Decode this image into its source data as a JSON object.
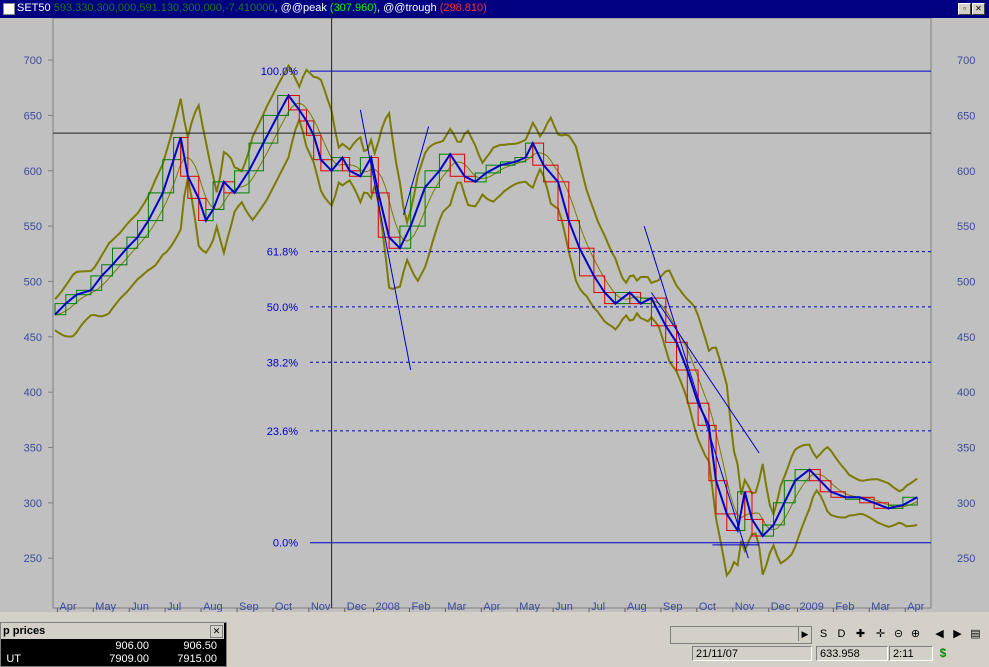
{
  "titlebar": {
    "symbol": "SET50",
    "values": "593.330,300,000,591.130,300,000,-7.410000",
    "peak_label": "@@peak",
    "peak_value": "(307.960)",
    "trough_label": "@@trough",
    "trough_value": "(298.810)"
  },
  "chart_data": {
    "type": "line",
    "y_ticks": [
      250,
      300,
      350,
      400,
      450,
      500,
      550,
      600,
      650,
      700
    ],
    "ylim": [
      205,
      738
    ],
    "x_ticks": [
      {
        "label": "Apr",
        "t": 0.4
      },
      {
        "label": "May",
        "t": 1.4
      },
      {
        "label": "Jun",
        "t": 2.4
      },
      {
        "label": "Jul",
        "t": 3.4
      },
      {
        "label": "Aug",
        "t": 4.4
      },
      {
        "label": "Sep",
        "t": 5.4
      },
      {
        "label": "Oct",
        "t": 6.4
      },
      {
        "label": "Nov",
        "t": 7.4
      },
      {
        "label": "Dec",
        "t": 8.4
      },
      {
        "label": "2008",
        "t": 9.2
      },
      {
        "label": "Feb",
        "t": 10.2
      },
      {
        "label": "Mar",
        "t": 11.2
      },
      {
        "label": "Apr",
        "t": 12.2
      },
      {
        "label": "May",
        "t": 13.2
      },
      {
        "label": "Jun",
        "t": 14.2
      },
      {
        "label": "Jul",
        "t": 15.2
      },
      {
        "label": "Aug",
        "t": 16.2
      },
      {
        "label": "Sep",
        "t": 17.2
      },
      {
        "label": "Oct",
        "t": 18.2
      },
      {
        "label": "Nov",
        "t": 19.2
      },
      {
        "label": "Dec",
        "t": 20.2
      },
      {
        "label": "2009",
        "t": 21.0
      },
      {
        "label": "Feb",
        "t": 22.0
      },
      {
        "label": "Mar",
        "t": 23.0
      },
      {
        "label": "Apr",
        "t": 24.0
      }
    ],
    "xlim": [
      0,
      24.3
    ],
    "price_series": {
      "name": "",
      "x": [
        0,
        0.3,
        0.6,
        1,
        1.3,
        1.6,
        2,
        2.3,
        2.6,
        3,
        3.3,
        3.5,
        3.7,
        4,
        4.2,
        4.4,
        4.7,
        5,
        5.4,
        5.8,
        6.2,
        6.5,
        6.8,
        7,
        7.2,
        7.4,
        7.7,
        8,
        8.2,
        8.5,
        8.8,
        9,
        9.3,
        9.6,
        9.9,
        10.3,
        10.7,
        11,
        11.4,
        11.7,
        12,
        12.4,
        12.8,
        13.1,
        13.3,
        13.6,
        14,
        14.3,
        14.6,
        15,
        15.3,
        15.6,
        16,
        16.3,
        16.6,
        17,
        17.3,
        17.6,
        17.9,
        18.2,
        18.4,
        18.7,
        19,
        19.2,
        19.4,
        19.7,
        20,
        20.3,
        20.6,
        21,
        21.3,
        21.6,
        22,
        22.4,
        22.8,
        23.2,
        23.6,
        24
      ],
      "values": [
        470,
        480,
        488,
        492,
        505,
        515,
        530,
        540,
        555,
        580,
        610,
        630,
        595,
        575,
        555,
        565,
        590,
        580,
        600,
        625,
        650,
        668,
        655,
        645,
        632,
        610,
        600,
        612,
        600,
        595,
        612,
        580,
        540,
        530,
        550,
        585,
        600,
        615,
        595,
        590,
        598,
        605,
        608,
        612,
        625,
        605,
        590,
        555,
        530,
        505,
        490,
        480,
        490,
        480,
        485,
        460,
        445,
        420,
        390,
        370,
        320,
        290,
        275,
        310,
        285,
        270,
        280,
        300,
        320,
        330,
        320,
        310,
        305,
        305,
        300,
        295,
        298,
        305
      ]
    },
    "fib_levels": [
      {
        "label": "100.0%",
        "value": 690,
        "style": "solid"
      },
      {
        "label": "61.8%",
        "value": 527,
        "style": "dashed"
      },
      {
        "label": "50.0%",
        "value": 477,
        "style": "dashed"
      },
      {
        "label": "38.2%",
        "value": 427,
        "style": "dashed"
      },
      {
        "label": "23.6%",
        "value": 365,
        "style": "dashed"
      },
      {
        "label": "0.0%",
        "value": 264,
        "style": "solid"
      }
    ],
    "crosshair": {
      "t": 7.7,
      "value": 634
    },
    "colors": {
      "price": "#0000cc",
      "band": "#7b7b00",
      "up": "#008000",
      "down": "#e00000",
      "fib": "#0000cc",
      "background": "#c0c0c0"
    }
  },
  "bottom": {
    "panel_title": "p prices",
    "rows": [
      {
        "name": "",
        "bid": "906.00",
        "ask": "906.50"
      },
      {
        "name": "UT",
        "bid": "7909.00",
        "ask": "7915.00"
      }
    ],
    "status_date": "21/11/07",
    "status_value": "633.958",
    "status_time": "2:11",
    "tools": [
      "S",
      "D",
      "✚",
      "✛",
      "⊝",
      "⊕",
      "◀",
      "▶",
      "▤"
    ]
  }
}
